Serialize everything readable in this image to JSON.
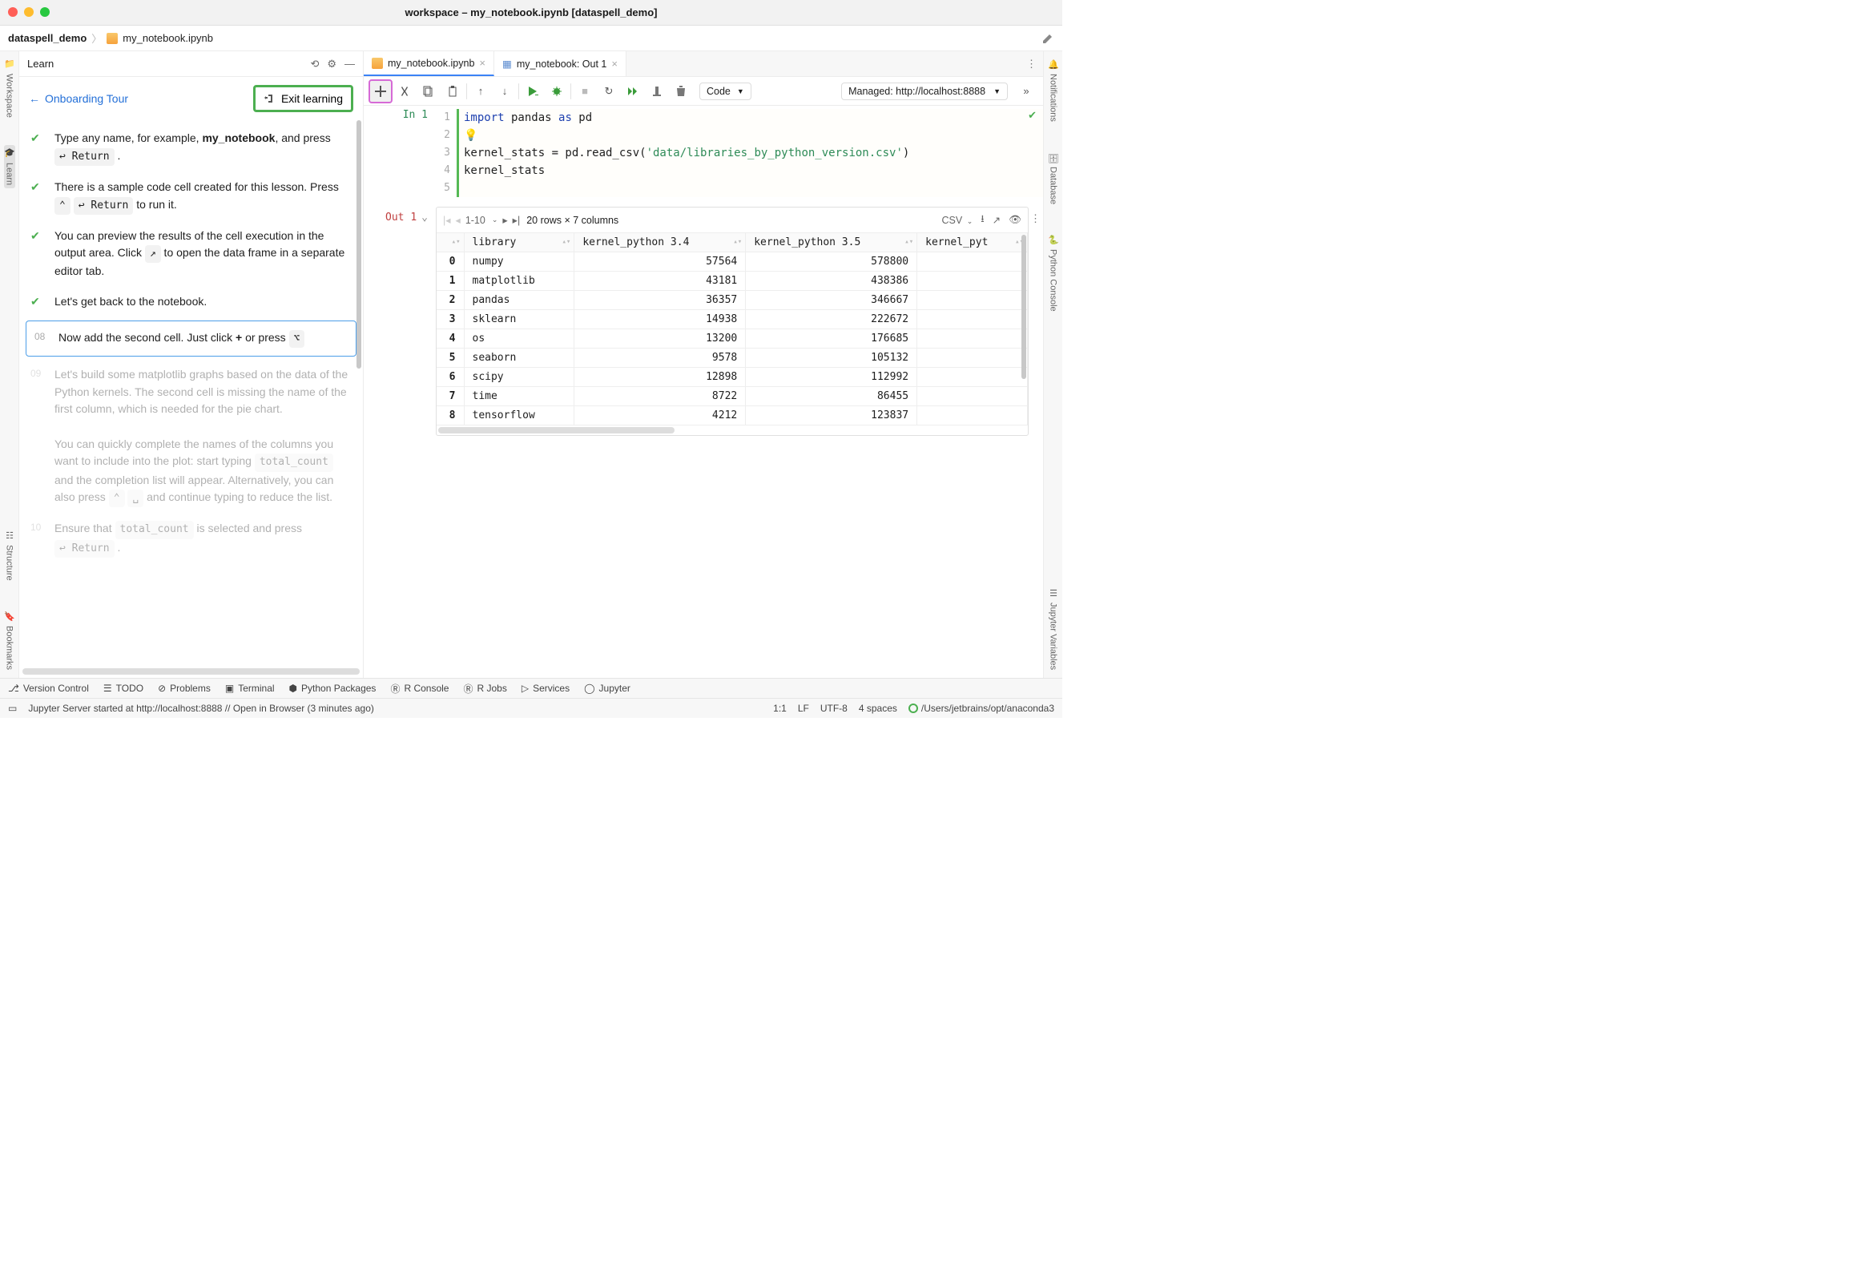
{
  "title": "workspace – my_notebook.ipynb [dataspell_demo]",
  "breadcrumb": {
    "project": "dataspell_demo",
    "file": "my_notebook.ipynb"
  },
  "left_rail": [
    "Workspace",
    "Learn",
    "Structure",
    "Bookmarks"
  ],
  "right_rail": [
    "Notifications",
    "Database",
    "Python Console",
    "Jupyter Variables"
  ],
  "learn": {
    "title": "Learn",
    "back": "Onboarding Tour",
    "exit": "Exit learning",
    "steps": [
      {
        "kind": "done",
        "html": "Type any name, for example, <b>my_notebook</b>, and press <span class='kbd'>↩ Return</span> ."
      },
      {
        "kind": "done",
        "html": "There is a sample code cell created for this lesson. Press <span class='kbd'>⌃</span> <span class='kbd'>↩ Return</span> to run it."
      },
      {
        "kind": "done",
        "html": "You can preview the results of the cell execution in the output area. Click <span class='kbd'>↗</span> to open the data frame in a separate editor tab."
      },
      {
        "kind": "done",
        "html": "Let's get back to the notebook."
      },
      {
        "kind": "current",
        "num": "08",
        "html": "Now add the second cell. Just click <b>+</b> or press <span class='kbd'>⌥</span>"
      },
      {
        "kind": "faded",
        "num": "09",
        "html": "Let's build some matplotlib graphs based on the data of the Python kernels. The second cell is missing the name of the first column, which is needed for the pie chart.<br><br>You can quickly complete the names of the columns you want to include into the plot: start typing <span class='kbd mono'>total_count</span> and the completion list will appear. Alternatively, you can also press <span class='kbd'>⌃</span> <span class='kbd'>␣</span> and continue typing to reduce the list."
      },
      {
        "kind": "faded",
        "num": "10",
        "html": "Ensure that <span class='kbd mono'>total_count</span> is selected and press <span class='kbd'>↩ Return</span> ."
      }
    ]
  },
  "tabs": [
    {
      "label": "my_notebook.ipynb",
      "icon": "notebook",
      "active": true
    },
    {
      "label": "my_notebook: Out 1",
      "icon": "table",
      "active": false
    }
  ],
  "toolbar": {
    "cellType": "Code",
    "managed": "Managed: http://localhost:8888"
  },
  "cell": {
    "in_label": "In 1",
    "lines": [
      {
        "n": "1",
        "tokens": [
          [
            "kw",
            "import"
          ],
          [
            "",
            " pandas "
          ],
          [
            "kw2",
            "as"
          ],
          [
            "",
            " pd"
          ]
        ]
      },
      {
        "n": "2",
        "tokens": [
          [
            "bulb",
            "💡"
          ]
        ]
      },
      {
        "n": "3",
        "tokens": [
          [
            "",
            "kernel_stats = pd.read_csv("
          ],
          [
            "str",
            "'data/libraries_by_python_version.csv'"
          ],
          [
            "",
            ")"
          ]
        ]
      },
      {
        "n": "4",
        "tokens": [
          [
            "",
            "kernel_stats"
          ]
        ]
      },
      {
        "n": "5",
        "tokens": [
          [
            "",
            ""
          ]
        ]
      }
    ]
  },
  "output": {
    "label": "Out 1",
    "range": "1-10",
    "summary": "20 rows × 7 columns",
    "csv": "CSV",
    "columns": [
      "",
      "library",
      "kernel_python 3.4",
      "kernel_python 3.5",
      "kernel_pyt"
    ],
    "rows": [
      [
        "0",
        "numpy",
        "57564",
        "578800"
      ],
      [
        "1",
        "matplotlib",
        "43181",
        "438386"
      ],
      [
        "2",
        "pandas",
        "36357",
        "346667"
      ],
      [
        "3",
        "sklearn",
        "14938",
        "222672"
      ],
      [
        "4",
        "os",
        "13200",
        "176685"
      ],
      [
        "5",
        "seaborn",
        "9578",
        "105132"
      ],
      [
        "6",
        "scipy",
        "12898",
        "112992"
      ],
      [
        "7",
        "time",
        "8722",
        "86455"
      ],
      [
        "8",
        "tensorflow",
        "4212",
        "123837"
      ]
    ]
  },
  "tool_windows": [
    "Version Control",
    "TODO",
    "Problems",
    "Terminal",
    "Python Packages",
    "R Console",
    "R Jobs",
    "Services",
    "Jupyter"
  ],
  "status": {
    "msg": "Jupyter Server started at http://localhost:8888 // Open in Browser (3 minutes ago)",
    "pos": "1:1",
    "eol": "LF",
    "enc": "UTF-8",
    "indent": "4 spaces",
    "env": "/Users/jetbrains/opt/anaconda3"
  }
}
